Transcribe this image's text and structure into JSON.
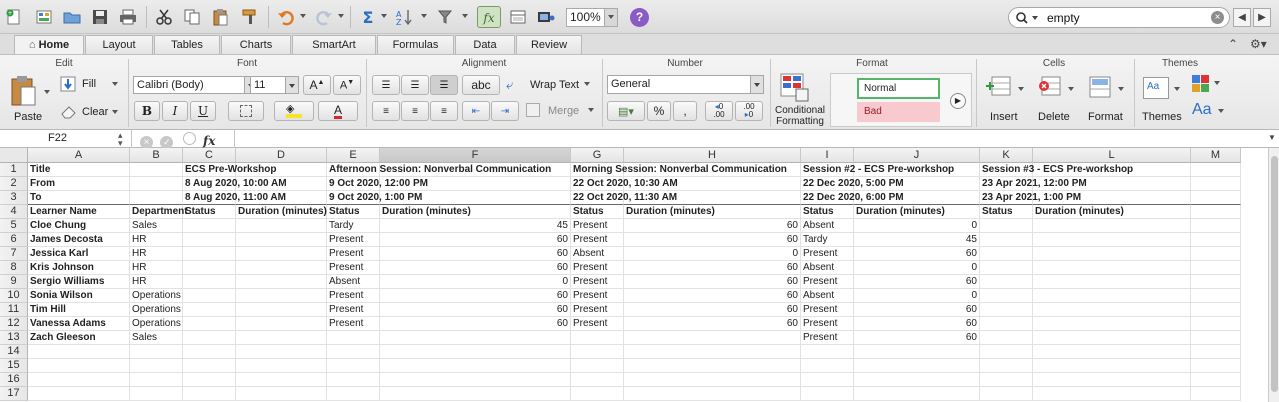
{
  "toolbar": {
    "zoom": "100%",
    "help": "?",
    "search_value": "empty",
    "fx": "fx"
  },
  "tabs": [
    "Home",
    "Layout",
    "Tables",
    "Charts",
    "SmartArt",
    "Formulas",
    "Data",
    "Review"
  ],
  "ribbon": {
    "groups": [
      "Edit",
      "Font",
      "Alignment",
      "Number",
      "Format",
      "Cells",
      "Themes"
    ],
    "paste": "Paste",
    "fill": "Fill",
    "clear": "Clear",
    "font_name": "Calibri (Body)",
    "font_size": "11",
    "bold": "B",
    "italic": "I",
    "underline": "U",
    "font_color": "A",
    "wrap_text": "Wrap Text",
    "abc": "abc",
    "merge": "Merge",
    "number_format": "General",
    "percent": "%",
    "comma": ",",
    "conditional_formatting": "Conditional Formatting",
    "style_normal": "Normal",
    "style_bad": "Bad",
    "insert": "Insert",
    "delete": "Delete",
    "format": "Format",
    "themes": "Themes",
    "aa": "Aa"
  },
  "formula_bar": {
    "name_box": "F22",
    "fx": "fx"
  },
  "grid": {
    "columns": [
      "A",
      "B",
      "C",
      "D",
      "E",
      "F",
      "G",
      "H",
      "I",
      "J",
      "K",
      "L",
      "M"
    ],
    "selected_column": "F",
    "row_numbers": [
      "1",
      "2",
      "3",
      "4",
      "5",
      "6",
      "7",
      "8",
      "9",
      "10",
      "11",
      "12",
      "13",
      "14",
      "15",
      "16",
      "17"
    ],
    "rows": [
      [
        "Title",
        "",
        "ECS Pre-Workshop",
        "",
        "Afternoon Session: Nonverbal Communication",
        "",
        "Morning Session: Nonverbal Communication",
        "",
        "Session #2 - ECS Pre-workshop",
        "",
        "Session #3 - ECS Pre-workshop",
        "",
        ""
      ],
      [
        "From",
        "",
        "8 Aug 2020, 10:00 AM",
        "",
        "9 Oct 2020, 12:00 PM",
        "",
        "22 Oct 2020, 10:30 AM",
        "",
        "22 Dec 2020, 5:00 PM",
        "",
        "23 Apr 2021, 12:00 PM",
        "",
        ""
      ],
      [
        "To",
        "",
        "8 Aug 2020, 11:00 AM",
        "",
        "9 Oct 2020, 1:00 PM",
        "",
        "22 Oct 2020, 11:30 AM",
        "",
        "22 Dec 2020, 6:00 PM",
        "",
        "23 Apr 2021, 1:00 PM",
        "",
        ""
      ],
      [
        "Learner Name",
        "Department",
        "Status",
        "Duration (minutes)",
        "Status",
        "Duration (minutes)",
        "Status",
        "Duration (minutes)",
        "Status",
        "Duration (minutes)",
        "Status",
        "Duration (minutes)",
        ""
      ],
      [
        "Cloe Chung",
        "Sales",
        "",
        "",
        "Tardy",
        "45",
        "Present",
        "60",
        "Absent",
        "0",
        "",
        "",
        ""
      ],
      [
        "James Decosta",
        "HR",
        "",
        "",
        "Present",
        "60",
        "Present",
        "60",
        "Tardy",
        "45",
        "",
        "",
        ""
      ],
      [
        "Jessica Karl",
        "HR",
        "",
        "",
        "Present",
        "60",
        "Absent",
        "0",
        "Present",
        "60",
        "",
        "",
        ""
      ],
      [
        "Kris Johnson",
        "HR",
        "",
        "",
        "Present",
        "60",
        "Present",
        "60",
        "Absent",
        "0",
        "",
        "",
        ""
      ],
      [
        "Sergio Williams",
        "HR",
        "",
        "",
        "Absent",
        "0",
        "Present",
        "60",
        "Present",
        "60",
        "",
        "",
        ""
      ],
      [
        "Sonia Wilson",
        "Operations",
        "",
        "",
        "Present",
        "60",
        "Present",
        "60",
        "Absent",
        "0",
        "",
        "",
        ""
      ],
      [
        "Tim Hill",
        "Operations",
        "",
        "",
        "Present",
        "60",
        "Present",
        "60",
        "Present",
        "60",
        "",
        "",
        ""
      ],
      [
        "Vanessa Adams",
        "Operations",
        "",
        "",
        "Present",
        "60",
        "Present",
        "60",
        "Present",
        "60",
        "",
        "",
        ""
      ],
      [
        "Zach Gleeson",
        "Sales",
        "",
        "",
        "",
        "",
        "",
        "",
        "Present",
        "60",
        "",
        "",
        ""
      ],
      [
        "",
        "",
        "",
        "",
        "",
        "",
        "",
        "",
        "",
        "",
        "",
        "",
        ""
      ],
      [
        "",
        "",
        "",
        "",
        "",
        "",
        "",
        "",
        "",
        "",
        "",
        "",
        ""
      ],
      [
        "",
        "",
        "",
        "",
        "",
        "",
        "",
        "",
        "",
        "",
        "",
        "",
        ""
      ],
      [
        "",
        "",
        "",
        "",
        "",
        "",
        "",
        "",
        "",
        "",
        "",
        "",
        ""
      ]
    ]
  }
}
